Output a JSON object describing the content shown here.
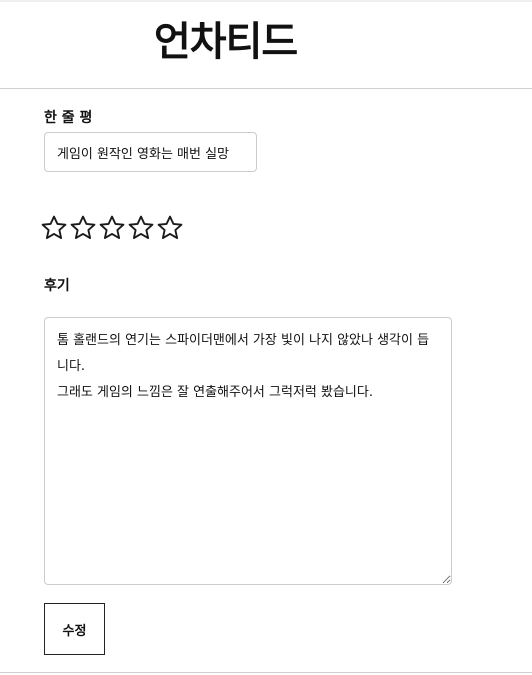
{
  "header": {
    "title": "언차티드"
  },
  "form": {
    "oneline_label": "한 줄 평",
    "oneline_value": "게임이 원작인 영화는 매번 실망",
    "rating": {
      "value": 0,
      "max": 5,
      "icon": "star-outline-icon"
    },
    "review_label": "후기",
    "review_value": "톰 홀랜드의 연기는 스파이더맨에서 가장 빛이 나지 않았나 생각이 듭니다.\n그래도 게임의 느낌은 잘 연출해주어서 그럭저럭 봤습니다.",
    "submit_label": "수정"
  }
}
